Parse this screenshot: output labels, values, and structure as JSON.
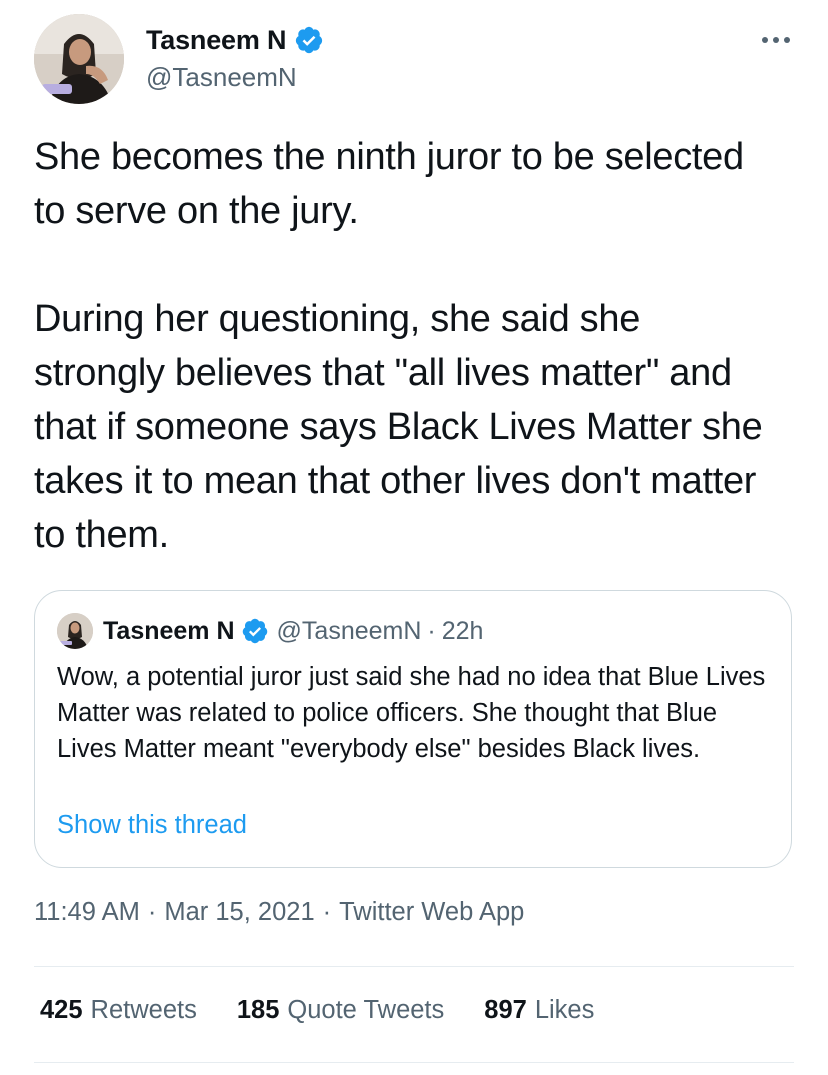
{
  "author": {
    "name": "Tasneem N",
    "handle": "@TasneemN",
    "verified": true
  },
  "icons": {
    "verified": "verified-badge-icon",
    "more": "more-dots-icon"
  },
  "colors": {
    "verified_badge": "#1d9bf0",
    "link": "#1d9bf0",
    "secondary_text": "#536471",
    "primary_text": "#0f1419",
    "border": "#cfd9de"
  },
  "tweet": {
    "paragraphs": [
      "She becomes the ninth juror to be selected to serve on the jury.",
      "During her questioning, she said she strongly believes that \"all lives matter\" and that if someone says Black Lives Matter she takes it to mean that other lives don't matter to them."
    ]
  },
  "quoted_tweet": {
    "name": "Tasneem N",
    "handle": "@TasneemN",
    "separator": "·",
    "time": "22h",
    "text": "Wow, a potential juror just said she had no idea that Blue Lives Matter was related to police officers. She thought that Blue Lives Matter meant \"everybody else\" besides Black lives.",
    "show_thread_label": "Show this thread"
  },
  "meta": {
    "time": "11:49 AM",
    "separator": "·",
    "date": "Mar 15, 2021",
    "source": "Twitter Web App"
  },
  "stats": {
    "retweets": {
      "count": "425",
      "label": "Retweets"
    },
    "quote_tweets": {
      "count": "185",
      "label": "Quote Tweets"
    },
    "likes": {
      "count": "897",
      "label": "Likes"
    }
  }
}
